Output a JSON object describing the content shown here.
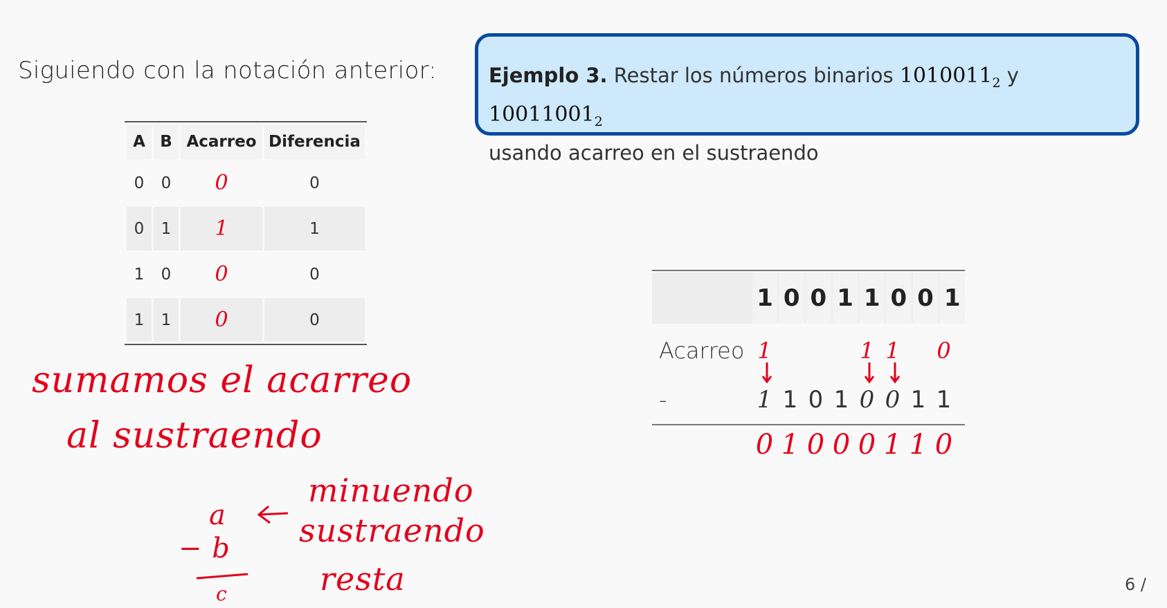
{
  "intro": "Siguiendo con la notación anterior:",
  "truth_table": {
    "headers": [
      "A",
      "B",
      "Acarreo",
      "Diferencia"
    ],
    "rows": [
      {
        "a": "0",
        "b": "0",
        "carry": "0",
        "diff": "0"
      },
      {
        "a": "0",
        "b": "1",
        "carry": "1",
        "diff": "1"
      },
      {
        "a": "1",
        "b": "0",
        "carry": "0",
        "diff": "0"
      },
      {
        "a": "1",
        "b": "1",
        "carry": "0",
        "diff": "0"
      }
    ]
  },
  "example": {
    "lead": "Ejemplo 3.",
    "text1": "Restar los números binarios",
    "num1": "1010011",
    "base1": "2",
    "joiner": "y",
    "num2": "10011001",
    "base2": "2",
    "text2": "usando acarreo en el sustraendo"
  },
  "subtraction": {
    "minuend": [
      "1",
      "0",
      "0",
      "1",
      "1",
      "0",
      "0",
      "1"
    ],
    "carry_label": "Acarreo",
    "carry": [
      "1",
      "",
      "",
      "",
      "1",
      "1",
      "",
      "0"
    ],
    "minus_label": "-",
    "subtrahend_written": [
      "1",
      "1",
      "0",
      "1",
      "0",
      "0",
      "1",
      "1"
    ],
    "result": [
      "0",
      "1",
      "0",
      "0",
      "0",
      "1",
      "1",
      "0"
    ]
  },
  "notes": {
    "line1": "sumamos el acarreo",
    "line2": "al sustraendo",
    "a": "a",
    "b": "b",
    "c": "c",
    "minuend": "minuendo",
    "subtrahend": "sustraendo",
    "resta": "resta"
  },
  "page": "6 /",
  "colors": {
    "ink_red": "#e3001b",
    "box_border": "#0a4a9e",
    "box_fill": "#cde9fb"
  }
}
